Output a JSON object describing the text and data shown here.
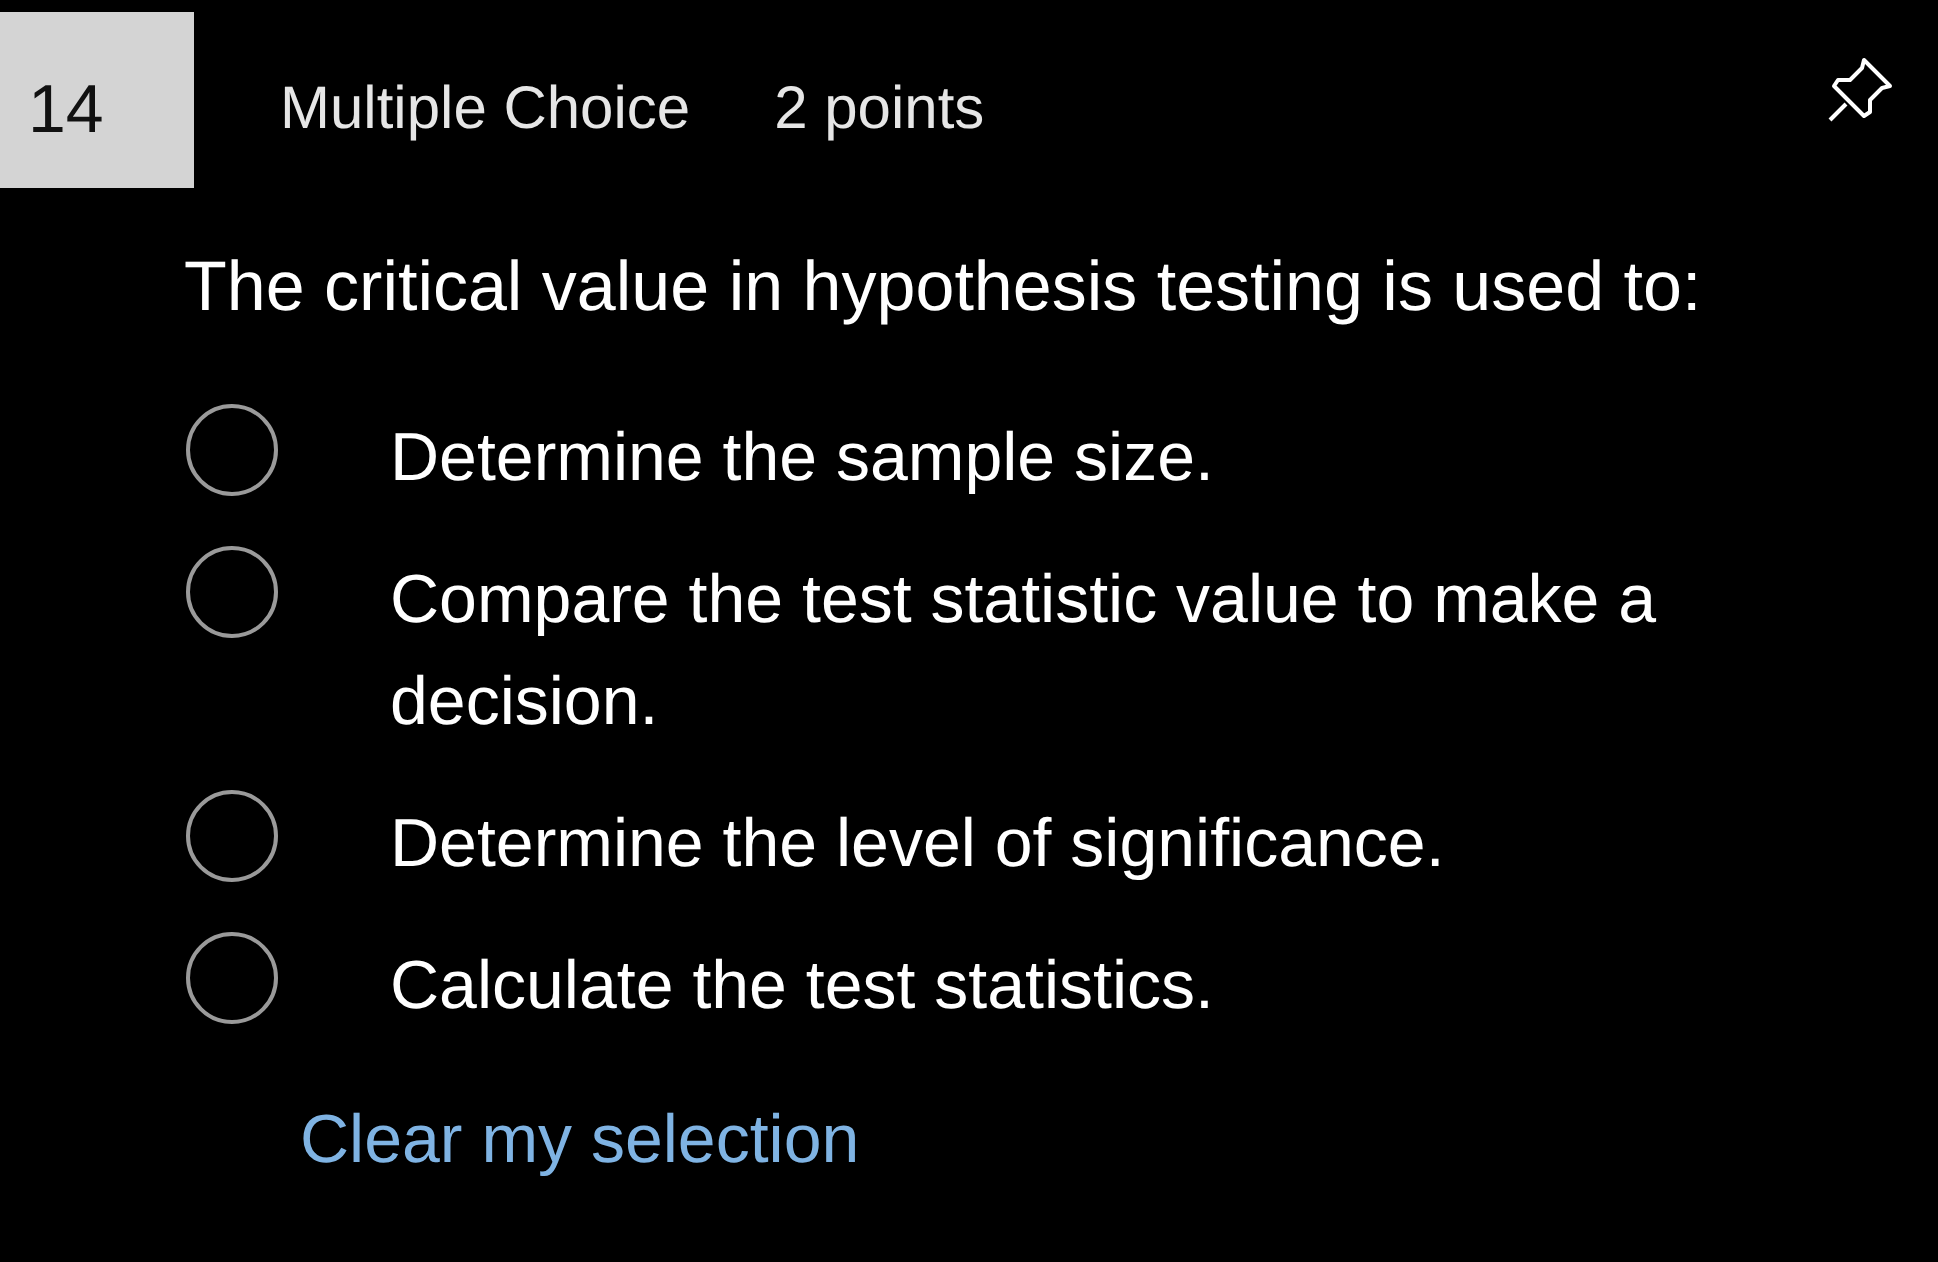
{
  "question": {
    "number": "14",
    "type": "Multiple Choice",
    "points": "2 points",
    "pinned": false,
    "prompt": "The critical value in hypothesis testing is used to:",
    "options": [
      {
        "label": "Determine the sample size.",
        "selected": false
      },
      {
        "label": "Compare the test statistic value to make a decision.",
        "selected": false
      },
      {
        "label": "Determine the level of significance.",
        "selected": false
      },
      {
        "label": "Calculate the test statistics.",
        "selected": false
      }
    ],
    "clear_link": "Clear my selection"
  }
}
